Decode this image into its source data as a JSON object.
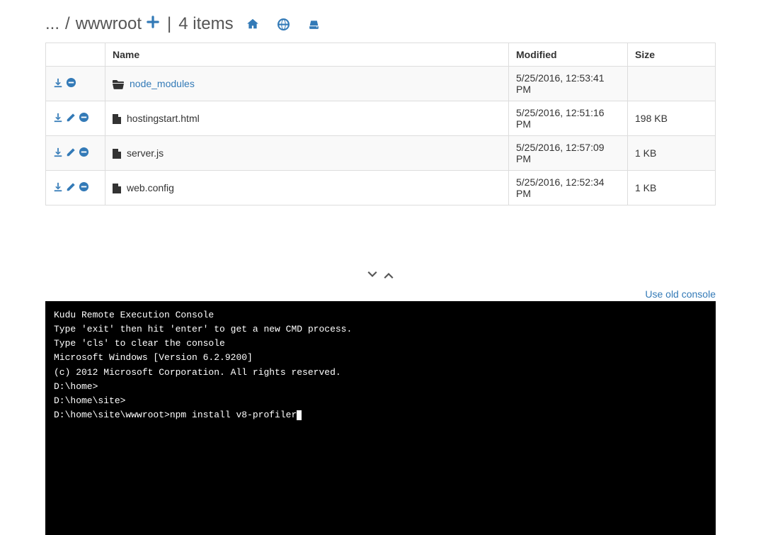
{
  "breadcrumb": {
    "leading": "...",
    "current": "wwwroot",
    "items_label": "4 items"
  },
  "table": {
    "headers": {
      "actions": "",
      "name": "Name",
      "modified": "Modified",
      "size": "Size"
    },
    "rows": [
      {
        "type": "folder",
        "name": "node_modules",
        "modified": "5/25/2016, 12:53:41 PM",
        "size": "",
        "actions": [
          "download",
          "delete"
        ]
      },
      {
        "type": "file",
        "name": "hostingstart.html",
        "modified": "5/25/2016, 12:51:16 PM",
        "size": "198 KB",
        "actions": [
          "download",
          "edit",
          "delete"
        ]
      },
      {
        "type": "file",
        "name": "server.js",
        "modified": "5/25/2016, 12:57:09 PM",
        "size": "1 KB",
        "actions": [
          "download",
          "edit",
          "delete"
        ]
      },
      {
        "type": "file",
        "name": "web.config",
        "modified": "5/25/2016, 12:52:34 PM",
        "size": "1 KB",
        "actions": [
          "download",
          "edit",
          "delete"
        ]
      }
    ]
  },
  "links": {
    "old_console": "Use old console"
  },
  "console": {
    "lines": [
      "Kudu Remote Execution Console",
      "Type 'exit' then hit 'enter' to get a new CMD process.",
      "Type 'cls' to clear the console",
      "",
      "Microsoft Windows [Version 6.2.9200]",
      "(c) 2012 Microsoft Corporation. All rights reserved.",
      "",
      "D:\\home>",
      "D:\\home\\site>"
    ],
    "prompt": "D:\\home\\site\\wwwroot>",
    "input": "npm install v8-profiler"
  }
}
